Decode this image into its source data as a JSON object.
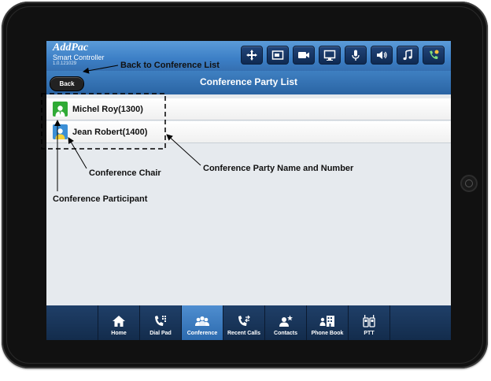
{
  "app": {
    "name": "AddPac",
    "subtitle": "Smart Controller",
    "version": "1.0.121029"
  },
  "toolbar": {
    "buttons": [
      {
        "icon": "move-icon"
      },
      {
        "icon": "screen-icon"
      },
      {
        "icon": "camera-icon"
      },
      {
        "icon": "monitor-icon"
      },
      {
        "icon": "microphone-icon"
      },
      {
        "icon": "speaker-icon"
      },
      {
        "icon": "music-note-icon"
      },
      {
        "icon": "phone-status-icon"
      }
    ]
  },
  "header": {
    "back_label": "Back",
    "title": "Conference Party List"
  },
  "parties": [
    {
      "name": "Michel Roy(1300)",
      "role": "chair",
      "avatar_color": "#2faa35"
    },
    {
      "name": "Jean Robert(1400)",
      "role": "participant",
      "avatar_color": "#3b8fd6"
    }
  ],
  "tabs": [
    {
      "label": "Home",
      "icon": "home-icon",
      "active": false
    },
    {
      "label": "Dial Pad",
      "icon": "dialpad-icon",
      "active": false
    },
    {
      "label": "Conference",
      "icon": "conference-icon",
      "active": true
    },
    {
      "label": "Recent Calls",
      "icon": "recent-calls-icon",
      "active": false
    },
    {
      "label": "Contacts",
      "icon": "contacts-icon",
      "active": false
    },
    {
      "label": "Phone Book",
      "icon": "phone-book-icon",
      "active": false
    },
    {
      "label": "PTT",
      "icon": "ptt-icon",
      "active": false
    }
  ],
  "annotations": {
    "back": "Back to Conference List",
    "chair": "Conference Chair",
    "party": "Conference Party Name and Number",
    "participant": "Conference Participant"
  },
  "colors": {
    "header_blue": "#3c7fc6",
    "toolbar_button": "#1a3a68",
    "tabbar": "#1a365b",
    "active_tab": "#3d7cc0"
  }
}
